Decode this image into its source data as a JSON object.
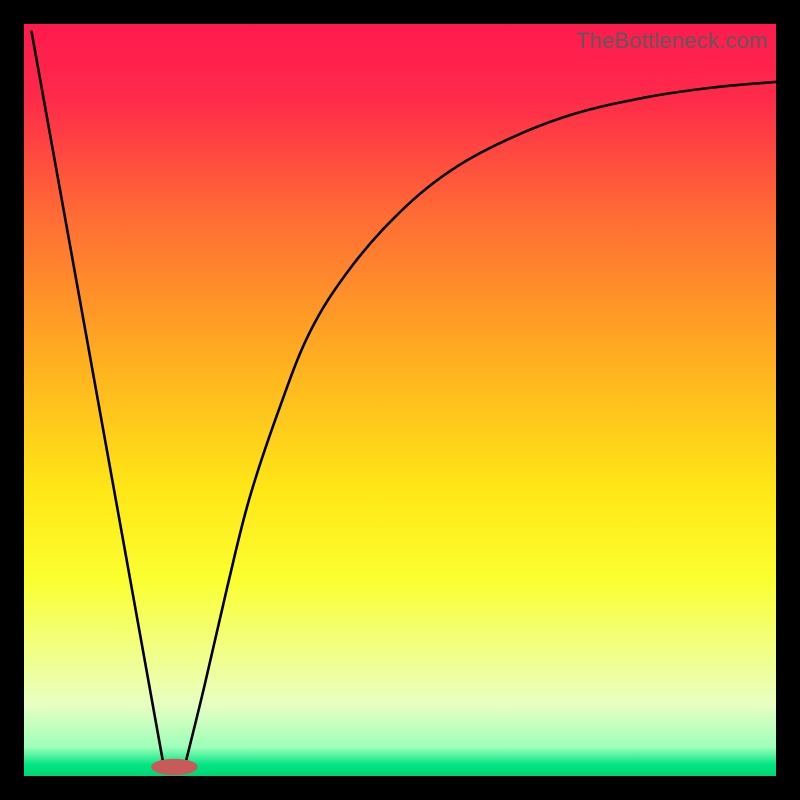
{
  "watermark": "TheBottleneck.com",
  "chart_data": {
    "type": "line",
    "title": "",
    "xlabel": "",
    "ylabel": "",
    "xlim": [
      0,
      100
    ],
    "ylim": [
      0,
      100
    ],
    "gradient_stops": [
      {
        "offset": 0.0,
        "color": "#ff1a4f"
      },
      {
        "offset": 0.1,
        "color": "#ff2a4a"
      },
      {
        "offset": 0.25,
        "color": "#ff6a35"
      },
      {
        "offset": 0.45,
        "color": "#ffb020"
      },
      {
        "offset": 0.62,
        "color": "#ffe716"
      },
      {
        "offset": 0.74,
        "color": "#fbff30"
      },
      {
        "offset": 0.82,
        "color": "#f3ff7a"
      },
      {
        "offset": 0.905,
        "color": "#e8ffc2"
      },
      {
        "offset": 0.962,
        "color": "#9cffba"
      },
      {
        "offset": 0.985,
        "color": "#00e583"
      },
      {
        "offset": 1.0,
        "color": "#00d676"
      }
    ],
    "series": [
      {
        "name": "left-line",
        "x": [
          1,
          18.5
        ],
        "values": [
          99,
          1.8
        ]
      },
      {
        "name": "right-curve",
        "x": [
          21.5,
          24,
          27,
          30,
          34,
          38,
          43,
          49,
          56,
          64,
          73,
          83,
          92,
          100
        ],
        "values": [
          1.8,
          12,
          25,
          37,
          49,
          59,
          67,
          74,
          80,
          84.5,
          88,
          90.3,
          91.6,
          92.3
        ]
      }
    ],
    "marker": {
      "x": 20,
      "y": 1.2,
      "rx": 3.1,
      "ry": 1.1,
      "fill": "#c85a5a"
    }
  }
}
